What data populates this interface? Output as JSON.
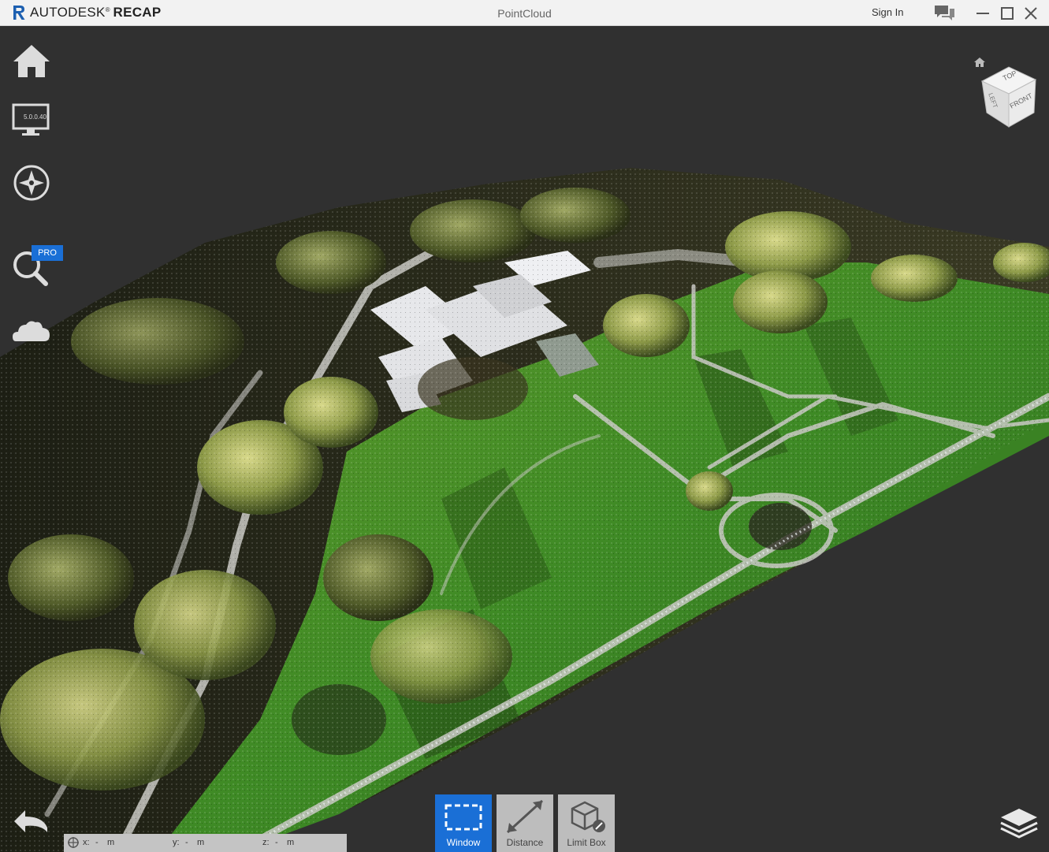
{
  "titlebar": {
    "brand": "AUTODESK",
    "brand_mark": "®",
    "product": "RECAP",
    "document_title": "PointCloud",
    "sign_in": "Sign In"
  },
  "left_toolbar": {
    "items": [
      {
        "name": "home-icon"
      },
      {
        "name": "display-settings-icon",
        "version_text": "5.0.0.40"
      },
      {
        "name": "navigation-compass-icon"
      },
      {
        "name": "search-icon",
        "badge": "PRO"
      },
      {
        "name": "cloud-icon"
      }
    ]
  },
  "viewcube": {
    "top": "TOP",
    "left": "LEFT",
    "front": "FRONT"
  },
  "bottom_tools": {
    "window": "Window",
    "distance": "Distance",
    "limit_box": "Limit Box",
    "active": "Window"
  },
  "coordinates": {
    "x_label": "x:",
    "x_value": "-",
    "x_unit": "m",
    "y_label": "y:",
    "y_value": "-",
    "y_unit": "m",
    "z_label": "z:",
    "z_value": "-",
    "z_unit": "m"
  },
  "colors": {
    "accent": "#1a6fd6",
    "viewport_bg": "#303030",
    "titlebar_bg": "#f2f2f2"
  }
}
